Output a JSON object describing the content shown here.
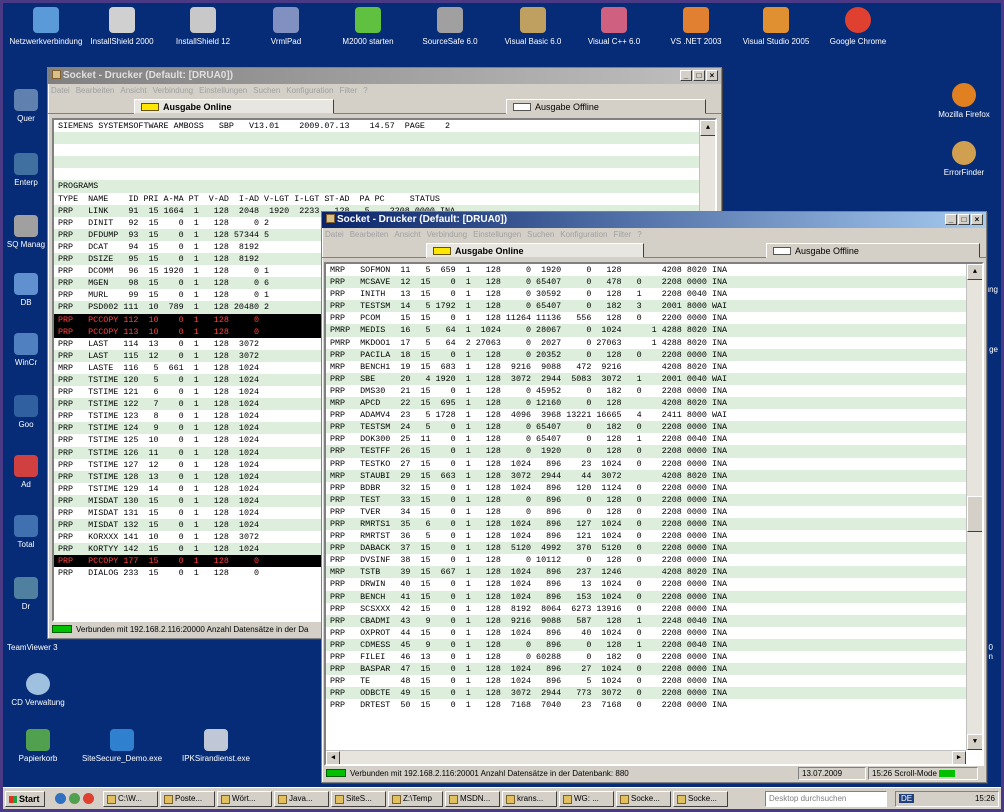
{
  "desktop": {
    "top_icons": [
      {
        "label": "Netzwerkverbindung",
        "icon": "network-icon",
        "color": "#5a9ad8"
      },
      {
        "label": "InstallShield 2000",
        "icon": "installshield-icon",
        "color": "#d0d0d0"
      },
      {
        "label": "InstallShield 12",
        "icon": "installshield-icon",
        "color": "#c8c8c8"
      },
      {
        "label": "VrmlPad",
        "icon": "vrmlpad-icon",
        "color": "#8090c0"
      },
      {
        "label": "M2000 starten",
        "icon": "m2000-icon",
        "color": "#60c040"
      },
      {
        "label": "SourceSafe 6.0",
        "icon": "sourcesafe-icon",
        "color": "#a0a0a0"
      },
      {
        "label": "Visual Basic 6.0",
        "icon": "vb-icon",
        "color": "#c0a060"
      },
      {
        "label": "Visual C++ 6.0",
        "icon": "vcpp-icon",
        "color": "#d06080"
      },
      {
        "label": "VS .NET 2003",
        "icon": "vsnet-icon",
        "color": "#e08030"
      },
      {
        "label": "Visual Studio 2005",
        "icon": "vs2005-icon",
        "color": "#e09030"
      },
      {
        "label": "Google Chrome",
        "icon": "chrome-icon",
        "color": "#e04030"
      }
    ],
    "left_icons": [
      "Quer",
      "Enterp",
      "SQ Manag",
      "DB",
      "WinCr",
      "Goo",
      "Ad",
      "Total",
      "Dr"
    ],
    "left_bottom": [
      {
        "label": "TeamViewer 3",
        "icon": "teamviewer-icon"
      },
      {
        "label": "CD Verwaltung",
        "icon": "cd-icon"
      },
      {
        "label": "Papierkorb",
        "icon": "recycle-bin-icon"
      }
    ],
    "bottom_icons": [
      {
        "label": "SiteSecure_Demo.exe",
        "icon": "exe-icon"
      },
      {
        "label": "IPKSirandienst.exe",
        "icon": "exe-icon"
      }
    ],
    "right_icons": [
      {
        "label": "Mozilla Firefox",
        "icon": "firefox-icon"
      },
      {
        "label": "ErrorFinder",
        "icon": "errorfinder-icon"
      }
    ],
    "right_fragments": [
      "erung",
      "ge",
      "30 on"
    ]
  },
  "window1": {
    "title": "Socket - Drucker (Default: [DRUA0])",
    "menu": [
      "Datei",
      "Bearbeiten",
      "Ansicht",
      "Verbindung",
      "Einstellungen",
      "Suchen",
      "Konfiguration",
      "Filter",
      "?"
    ],
    "tab_online": "Ausgabe Online",
    "tab_offline": "Ausgabe Offline",
    "lines": [
      {
        "t": "SIEMENS SYSTEMSOFTWARE AMBOSS   SBP   V13.01    2009.07.13    14.57  PAGE    2",
        "s": "w"
      },
      {
        "t": "",
        "s": "g"
      },
      {
        "t": "",
        "s": "w"
      },
      {
        "t": "",
        "s": "g"
      },
      {
        "t": "",
        "s": "w"
      },
      {
        "t": "PROGRAMS",
        "s": "g"
      },
      {
        "t": "TYPE  NAME    ID PRI A-MA PT  V-AD  I-AD V-LGT I-LGT ST-AD  PA PC     STATUS",
        "s": "w"
      },
      {
        "t": "PRP   LINK    91  15 1664  1   128  2048  1920  2233   128   5    2208 0000 INA",
        "s": "g"
      },
      {
        "t": "PRP   DINIT   92  15    0  1   128     0 2",
        "s": "w"
      },
      {
        "t": "PRP   DFDUMP  93  15    0  1   128 57344 5",
        "s": "g"
      },
      {
        "t": "PRP   DCAT    94  15    0  1   128  8192",
        "s": "w"
      },
      {
        "t": "PRP   DSIZE   95  15    0  1   128  8192",
        "s": "g"
      },
      {
        "t": "PRP   DCOMM   96  15 1920  1   128     0 1",
        "s": "w"
      },
      {
        "t": "PRP   MGEN    98  15    0  1   128     0 6",
        "s": "g"
      },
      {
        "t": "PRP   MURL    99  15    0  1   128     0 1",
        "s": "w"
      },
      {
        "t": "PRP   PSD002 111  10  789  1   128 20480 2",
        "s": "g"
      },
      {
        "t": "PRP   PCCOPY 112  10    0  1   128     0",
        "s": "r"
      },
      {
        "t": "PRP   PCCOPY 113  10    0  1   128     0",
        "s": "r"
      },
      {
        "t": "PRP   LAST   114  13    0  1   128  3072",
        "s": "w"
      },
      {
        "t": "PRP   LAST   115  12    0  1   128  3072",
        "s": "g"
      },
      {
        "t": "MRP   LASTE  116   5  661  1   128  1024",
        "s": "w"
      },
      {
        "t": "PRP   TSTIME 120   5    0  1   128  1024",
        "s": "g"
      },
      {
        "t": "PRP   TSTIME 121   6    0  1   128  1024",
        "s": "w"
      },
      {
        "t": "PRP   TSTIME 122   7    0  1   128  1024",
        "s": "g"
      },
      {
        "t": "PRP   TSTIME 123   8    0  1   128  1024",
        "s": "w"
      },
      {
        "t": "PRP   TSTIME 124   9    0  1   128  1024",
        "s": "g"
      },
      {
        "t": "PRP   TSTIME 125  10    0  1   128  1024",
        "s": "w"
      },
      {
        "t": "PRP   TSTIME 126  11    0  1   128  1024",
        "s": "g"
      },
      {
        "t": "PRP   TSTIME 127  12    0  1   128  1024",
        "s": "w"
      },
      {
        "t": "PRP   TSTIME 128  13    0  1   128  1024",
        "s": "g"
      },
      {
        "t": "PRP   TSTIME 129  14    0  1   128  1024",
        "s": "w"
      },
      {
        "t": "PRP   MISDAT 130  15    0  1   128  1024",
        "s": "g"
      },
      {
        "t": "PRP   MISDAT 131  15    0  1   128  1024",
        "s": "w"
      },
      {
        "t": "PRP   MISDAT 132  15    0  1   128  1024",
        "s": "g"
      },
      {
        "t": "PRP   KORXXX 141  10    0  1   128  3072",
        "s": "w"
      },
      {
        "t": "PRP   KORTYY 142  15    0  1   128  1024",
        "s": "g"
      },
      {
        "t": "PRP   PCCOPY 177  15    0  1   128     0",
        "s": "r"
      },
      {
        "t": "PRP   DIALOG 233  15    0  1   128     0",
        "s": "w"
      }
    ],
    "status_text": "Verbunden mit 192.168.2.116:20000  Anzahl Datensätze in der Da"
  },
  "window2": {
    "title": "Socket - Drucker (Default: [DRUA0])",
    "menu": [
      "Datei",
      "Bearbeiten",
      "Ansicht",
      "Verbindung",
      "Einstellungen",
      "Suchen",
      "Konfiguration",
      "Filter",
      "?"
    ],
    "tab_online": "Ausgabe Online",
    "tab_offline": "Ausgabe Offline",
    "lines": [
      {
        "t": "MRP   SOFMON  11   5  659  1   128     0  1920     0   128        4208 8020 INA",
        "s": "w"
      },
      {
        "t": "PRP   MCSAVE  12  15    0  1   128     0 65407     0   478   0    2208 0000 INA",
        "s": "g"
      },
      {
        "t": "PRP   INITH   13  15    0  1   128     0 30592     0   128   1    2208 0040 INA",
        "s": "w"
      },
      {
        "t": "PRP   TESTSM  14   5 1792  1   128     0 65407     0   182   3    2001 8000 WAI",
        "s": "g"
      },
      {
        "t": "PRP   PCOM    15  15    0  1   128 11264 11136   556   128   0    2200 0000 INA",
        "s": "w"
      },
      {
        "t": "PMRP  MEDIS   16   5   64  1  1024     0 28067     0  1024      1 4288 8020 INA",
        "s": "g"
      },
      {
        "t": "PMRP  MKDOO1  17   5   64  2 27063     0  2027     0 27063      1 4288 8020 INA",
        "s": "w"
      },
      {
        "t": "PRP   PACILA  18  15    0  1   128     0 20352     0   128   0    2208 0000 INA",
        "s": "g"
      },
      {
        "t": "MRP   BENCH1  19  15  683  1   128  9216  9088   472  9216        4208 8020 INA",
        "s": "w"
      },
      {
        "t": "PRP   SBE     20   4 1920  1   128  3072  2944  5083  3072   1    2001 0040 WAI",
        "s": "g"
      },
      {
        "t": "PRP   DMS30   21  15    0  1   128     0 45952     0   182   0    2208 0000 INA",
        "s": "w"
      },
      {
        "t": "MRP   APCD    22  15  695  1   128     0 12160     0   128        4208 8020 INA",
        "s": "g"
      },
      {
        "t": "PRP   ADAMV4  23   5 1728  1   128  4096  3968 13221 16665   4    2411 8000 WAI",
        "s": "w"
      },
      {
        "t": "PRP   TESTSM  24   5    0  1   128     0 65407     0   182   0    2208 0000 INA",
        "s": "g"
      },
      {
        "t": "PRP   DOK300  25  11    0  1   128     0 65407     0   128   1    2208 0040 INA",
        "s": "w"
      },
      {
        "t": "PRP   TESTFF  26  15    0  1   128     0  1920     0   128   0    2208 0000 INA",
        "s": "g"
      },
      {
        "t": "PRP   TESTKO  27  15    0  1   128  1024   896    23  1024   0    2208 0000 INA",
        "s": "w"
      },
      {
        "t": "MRP   STAUBI  29  15  663  1   128  3072  2944    44  3072        4208 8020 INA",
        "s": "g"
      },
      {
        "t": "PRP   BDBR    32  15    0  1   128  1024   896   120  1124   0    2208 0000 INA",
        "s": "w"
      },
      {
        "t": "PRP   TEST    33  15    0  1   128     0   896     0   128   0    2208 0000 INA",
        "s": "g"
      },
      {
        "t": "PRP   TVER    34  15    0  1   128     0   896     0   128   0    2208 0000 INA",
        "s": "w"
      },
      {
        "t": "PRP   RMRTS1  35   6    0  1   128  1024   896   127  1024   0    2208 0000 INA",
        "s": "g"
      },
      {
        "t": "PRP   RMRTST  36   5    0  1   128  1024   896   121  1024   0    2208 0000 INA",
        "s": "w"
      },
      {
        "t": "PRP   DABACK  37  15    0  1   128  5120  4992   370  5120   0    2208 0000 INA",
        "s": "g"
      },
      {
        "t": "PRP   DVSINF  38  15    0  1   128     0 10112     0   128   0    2208 0000 INA",
        "s": "w"
      },
      {
        "t": "MRP   TSTB    39  15  667  1   128  1024   896   237  1246        4208 8020 INA",
        "s": "g"
      },
      {
        "t": "PRP   DRWIN   40  15    0  1   128  1024   896    13  1024   0    2208 0000 INA",
        "s": "w"
      },
      {
        "t": "PRP   BENCH   41  15    0  1   128  1024   896   153  1024   0    2208 0000 INA",
        "s": "g"
      },
      {
        "t": "PRP   SCSXXX  42  15    0  1   128  8192  8064  6273 13916   0    2208 0000 INA",
        "s": "w"
      },
      {
        "t": "PRP   CBADMI  43   9    0  1   128  9216  9088   587   128   1    2248 0040 INA",
        "s": "g"
      },
      {
        "t": "PRP   OXPROT  44  15    0  1   128  1024   896    40  1024   0    2208 0000 INA",
        "s": "w"
      },
      {
        "t": "PRP   CDMESS  45   9    0  1   128     0   896     0   128   1    2208 0040 INA",
        "s": "g"
      },
      {
        "t": "PRP   FILEI   46  13    0  1   128     0 60288     0   182   0    2208 0000 INA",
        "s": "w"
      },
      {
        "t": "PRP   BASPAR  47  15    0  1   128  1024   896    27  1024   0    2208 0000 INA",
        "s": "g"
      },
      {
        "t": "PRP   TE      48  15    0  1   128  1024   896     5  1024   0    2208 0000 INA",
        "s": "w"
      },
      {
        "t": "PRP   ODBCTE  49  15    0  1   128  3072  2944   773  3072   0    2208 0000 INA",
        "s": "g"
      },
      {
        "t": "PRP   DRTEST  50  15    0  1   128  7168  7040    23  7168   0    2208 0000 INA",
        "s": "w"
      }
    ],
    "status_text": "Verbunden mit 192.168.2.116:20001  Anzahl Datensätze in der Datenbank: 880",
    "status_date": "13.07.2009",
    "status_time": "15:26",
    "status_mode": "Scroll-Mode"
  },
  "taskbar": {
    "start": "Start",
    "buttons": [
      "C:\\W...",
      "Poste...",
      "Wört...",
      "Java...",
      "SiteS...",
      "Z:\\Temp",
      "MSDN...",
      "krans...",
      "WG: ...",
      "Socke...",
      "Socke..."
    ],
    "search_placeholder": "Desktop durchsuchen",
    "lang": "DE",
    "clock": "15:26"
  }
}
